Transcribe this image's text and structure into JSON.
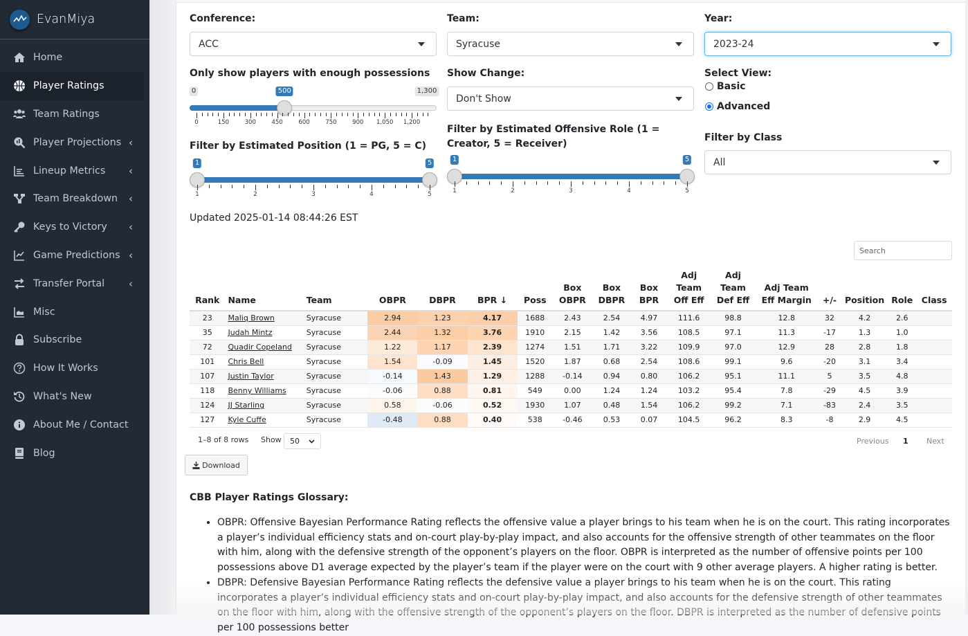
{
  "brand": {
    "name": "EvanMiya"
  },
  "sidebar": {
    "items": [
      {
        "label": "Home",
        "icon": "home-icon",
        "active": false,
        "chevron": false
      },
      {
        "label": "Player Ratings",
        "icon": "basketball-icon",
        "active": true,
        "chevron": false
      },
      {
        "label": "Team Ratings",
        "icon": "users-icon",
        "active": false,
        "chevron": false
      },
      {
        "label": "Player Projections",
        "icon": "search-chart-icon",
        "active": false,
        "chevron": true
      },
      {
        "label": "Lineup Metrics",
        "icon": "bar-chart-icon",
        "active": false,
        "chevron": true
      },
      {
        "label": "Team Breakdown",
        "icon": "sitemap-icon",
        "active": false,
        "chevron": true
      },
      {
        "label": "Keys to Victory",
        "icon": "key-icon",
        "active": false,
        "chevron": true
      },
      {
        "label": "Game Predictions",
        "icon": "line-chart-icon",
        "active": false,
        "chevron": true
      },
      {
        "label": "Transfer Portal",
        "icon": "transfer-arrows-icon",
        "active": false,
        "chevron": true
      },
      {
        "label": "Misc",
        "icon": "area-chart-icon",
        "active": false,
        "chevron": false
      },
      {
        "label": "Subscribe",
        "icon": "lock-icon",
        "active": false,
        "chevron": false
      },
      {
        "label": "How It Works",
        "icon": "question-circle-icon",
        "active": false,
        "chevron": false
      },
      {
        "label": "What's New",
        "icon": "history-icon",
        "active": false,
        "chevron": false
      },
      {
        "label": "About Me / Contact",
        "icon": "info-circle-icon",
        "active": false,
        "chevron": false
      },
      {
        "label": "Blog",
        "icon": "book-icon",
        "active": false,
        "chevron": false
      }
    ],
    "chevron_glyph": "‹"
  },
  "filters": {
    "conference": {
      "label": "Conference:",
      "value": "ACC"
    },
    "team": {
      "label": "Team:",
      "value": "Syracuse"
    },
    "year": {
      "label": "Year:",
      "value": "2023-24"
    },
    "possessions": {
      "label": "Only show players with enough possessions",
      "min": 0,
      "max": 1300,
      "value": 500,
      "min_label": "0",
      "max_label": "1,300",
      "value_label": "500",
      "ticks": [
        "0",
        "150",
        "300",
        "450",
        "600",
        "750",
        "900",
        "1,050",
        "1,200"
      ]
    },
    "show_change": {
      "label": "Show Change:",
      "value": "Don't Show"
    },
    "select_view": {
      "label": "Select View:",
      "options": [
        {
          "label": "Basic",
          "checked": false
        },
        {
          "label": "Advanced",
          "checked": true
        }
      ]
    },
    "position": {
      "label": "Filter by Estimated Position (1 = PG, 5 = C)",
      "min": 1,
      "max": 5,
      "low": 1,
      "high": 5,
      "low_label": "1",
      "high_label": "5",
      "ticks": [
        "1",
        "2",
        "3",
        "4",
        "5"
      ]
    },
    "role": {
      "label": "Filter by Estimated Offensive Role (1 = Creator, 5 = Receiver)",
      "min": 1,
      "max": 5,
      "low": 1,
      "high": 5,
      "low_label": "1",
      "high_label": "5",
      "ticks": [
        "1",
        "2",
        "3",
        "4",
        "5"
      ]
    },
    "class": {
      "label": "Filter by Class",
      "value": "All"
    }
  },
  "updated": "Updated 2025-01-14 08:44:26 EST",
  "search": {
    "placeholder": "Search"
  },
  "table": {
    "columns": [
      "Rank",
      "Name",
      "Team",
      "OBPR",
      "DBPR",
      "BPR ↓",
      "Poss",
      "Box OBPR",
      "Box DBPR",
      "Box BPR",
      "Adj Team Off Eff",
      "Adj Team Def Eff",
      "Adj Team Eff Margin",
      "+/-",
      "Position",
      "Role",
      "Class"
    ],
    "rows": [
      [
        "23",
        "Maliq Brown",
        "Syracuse",
        "2.94",
        "1.23",
        "4.17",
        "1688",
        "2.43",
        "2.54",
        "4.97",
        "111.6",
        "98.8",
        "12.8",
        "32",
        "4.2",
        "2.6",
        ""
      ],
      [
        "35",
        "Judah Mintz",
        "Syracuse",
        "2.44",
        "1.32",
        "3.76",
        "1910",
        "2.15",
        "1.42",
        "3.56",
        "108.5",
        "97.1",
        "11.3",
        "-17",
        "1.3",
        "1.0",
        ""
      ],
      [
        "72",
        "Quadir Copeland",
        "Syracuse",
        "1.22",
        "1.17",
        "2.39",
        "1274",
        "1.51",
        "1.71",
        "3.22",
        "109.9",
        "97.0",
        "12.9",
        "28",
        "2.8",
        "1.8",
        ""
      ],
      [
        "101",
        "Chris Bell",
        "Syracuse",
        "1.54",
        "-0.09",
        "1.45",
        "1520",
        "1.87",
        "0.68",
        "2.54",
        "108.6",
        "99.1",
        "9.6",
        "-20",
        "3.1",
        "3.4",
        ""
      ],
      [
        "107",
        "Justin Taylor",
        "Syracuse",
        "-0.14",
        "1.43",
        "1.29",
        "1288",
        "-0.14",
        "0.94",
        "0.80",
        "106.2",
        "95.1",
        "11.1",
        "5",
        "3.5",
        "4.8",
        ""
      ],
      [
        "118",
        "Benny Williams",
        "Syracuse",
        "-0.06",
        "0.88",
        "0.81",
        "549",
        "0.00",
        "1.24",
        "1.24",
        "103.2",
        "95.4",
        "7.8",
        "-29",
        "4.5",
        "3.9",
        ""
      ],
      [
        "124",
        "JJ Starling",
        "Syracuse",
        "0.58",
        "-0.06",
        "0.52",
        "1930",
        "1.07",
        "0.48",
        "1.54",
        "106.2",
        "99.2",
        "7.1",
        "-83",
        "2.4",
        "3.5",
        ""
      ],
      [
        "127",
        "Kyle Cuffe",
        "Syracuse",
        "-0.48",
        "0.88",
        "0.40",
        "538",
        "-0.46",
        "0.53",
        "0.07",
        "104.5",
        "96.2",
        "8.3",
        "-8",
        "2.9",
        "4.5",
        ""
      ]
    ],
    "heat_colors": {
      "positive": "#fbc08f",
      "negative": "#dfe9f7"
    }
  },
  "pagination": {
    "info": "1–8 of 8 rows",
    "show_label": "Show",
    "page_size": "50",
    "previous": "Previous",
    "current": "1",
    "next": "Next"
  },
  "download": {
    "label": "Download"
  },
  "glossary": {
    "title": "CBB Player Ratings Glossary:",
    "items": [
      "OBPR: Offensive Bayesian Performance Rating reflects the offensive value a player brings to his team when he is on the court. This rating incorporates a player’s individual efficiency stats and on-court play-by-play impact, and also accounts for the offensive strength of other teammates on the floor with him, along with the defensive strength of the opponent’s players on the floor. OBPR is interpreted as the number of offensive points per 100 possessions above D1 average expected by the player’s team if the player were on the court with 9 other average players. A higher rating is better.",
      "DBPR: Defensive Bayesian Performance Rating reflects the defensive value a player brings to his team when he is on the court. This rating incorporates a player’s individual efficiency stats and on-court play-by-play impact, and also accounts for the defensive strength of other teammates on the floor with him, along with the offensive strength of the opponent’s players on the floor. DBPR is interpreted as the number of defensive points per 100 possessions better"
    ]
  }
}
